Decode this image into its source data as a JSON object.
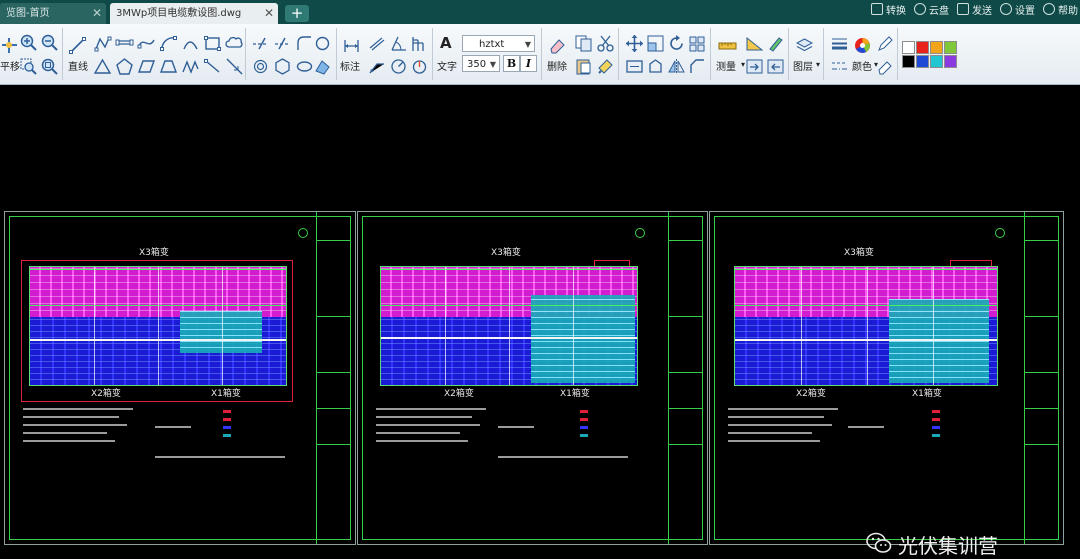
{
  "tabs": [
    {
      "label": "览图-首页",
      "close": "✕"
    },
    {
      "label": "3MWp项目电缆敷设图.dwg",
      "close": "✕"
    }
  ],
  "add_tab": "+",
  "top_actions": [
    {
      "icon": "convert-icon",
      "label": "转换"
    },
    {
      "icon": "cloud-icon",
      "label": "云盘"
    },
    {
      "icon": "send-icon",
      "label": "发送"
    },
    {
      "icon": "settings-icon",
      "label": "设置"
    },
    {
      "icon": "help-icon",
      "label": "帮助"
    }
  ],
  "ribbon": {
    "move_label": "平移",
    "line_label": "直线",
    "dimension_label": "标注",
    "text_group_label": "文字",
    "text_glyph": "A",
    "font_value": "hztxt",
    "size_value": "350",
    "bold": "B",
    "italic": "I",
    "delete_label": "删除",
    "measure_label": "测量",
    "layer_label": "图层",
    "color_label": "颜色",
    "swatches": [
      "#ffffff",
      "#e8231b",
      "#f2a51a",
      "#7ec83a",
      "#000000",
      "#1f4ad6",
      "#21c6d2",
      "#8b3ae0"
    ]
  },
  "drawing": {
    "sheets": [
      {
        "top_label": "X3箱变",
        "bottom_left": "X2箱变",
        "bottom_right": "X1箱变"
      },
      {
        "top_label": "X3箱变",
        "bottom_left": "X2箱变",
        "bottom_right": "X1箱变"
      },
      {
        "top_label": "X3箱变",
        "bottom_left": "X2箱变",
        "bottom_right": "X1箱变"
      }
    ]
  },
  "watermark": "光伏集训营"
}
